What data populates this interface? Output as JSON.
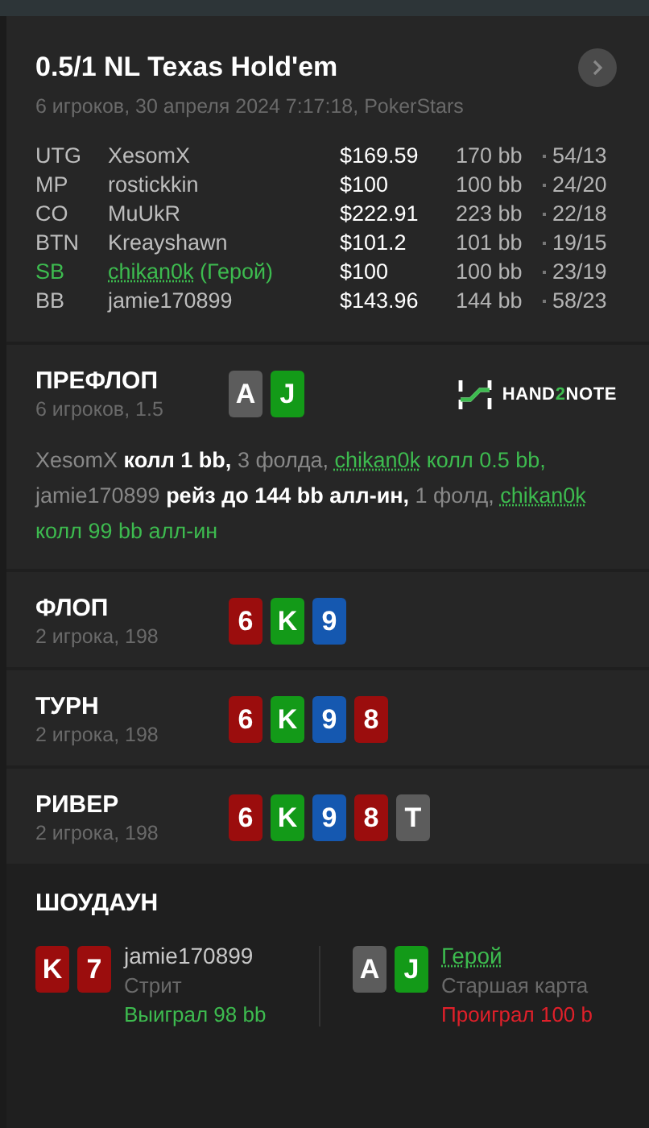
{
  "hand": {
    "title": "0.5/1 NL Texas Hold'em",
    "subtitle": "6 игроков, 30 апреля 2024 7:17:18, PokerStars"
  },
  "players": [
    {
      "position": "UTG",
      "name": "XesomX",
      "stack": "$169.59",
      "bb": "170 bb",
      "stats": "54/13",
      "hero": false
    },
    {
      "position": "MP",
      "name": "rostickkin",
      "stack": "$100",
      "bb": "100 bb",
      "stats": "24/20",
      "hero": false
    },
    {
      "position": "CO",
      "name": "MuUkR",
      "stack": "$222.91",
      "bb": "223 bb",
      "stats": "22/18",
      "hero": false
    },
    {
      "position": "BTN",
      "name": "Kreayshawn",
      "stack": "$101.2",
      "bb": "101 bb",
      "stats": "19/15",
      "hero": false
    },
    {
      "position": "SB",
      "name": "chikan0k",
      "hero_tag": "(Герой)",
      "stack": "$100",
      "bb": "100 bb",
      "stats": "23/19",
      "hero": true
    },
    {
      "position": "BB",
      "name": "jamie170899",
      "stack": "$143.96",
      "bb": "144 bb",
      "stats": "58/23",
      "hero": false
    }
  ],
  "logo": {
    "parts": [
      "HAND",
      "2",
      "NOTE"
    ]
  },
  "streets": [
    {
      "title": "ПРЕФЛОП",
      "info": "6 игроков, 1.5",
      "cards": [
        {
          "rank": "A",
          "color": "#5c5c5c"
        },
        {
          "rank": "J",
          "color": "#139a18"
        }
      ],
      "actions": [
        {
          "kind": "player",
          "text": "XesomX",
          "hero": false
        },
        {
          "kind": "action",
          "text": " колл 1 bb,",
          "hero": false
        },
        {
          "kind": "other",
          "text": " 3 фолда, ",
          "hero": false
        },
        {
          "kind": "player",
          "text": "chikan0k",
          "hero": true
        },
        {
          "kind": "action",
          "text": " колл 0.5 bb,",
          "hero": true
        },
        {
          "kind": "player",
          "text": " jamie170899",
          "hero": false
        },
        {
          "kind": "action",
          "text": " рейз до 144 bb алл-ин,",
          "hero": false
        },
        {
          "kind": "other",
          "text": " 1 фолд, ",
          "hero": false
        },
        {
          "kind": "player",
          "text": "chikan0k",
          "hero": true
        },
        {
          "kind": "action",
          "text": " колл 99 bb алл-ин",
          "hero": true
        }
      ]
    },
    {
      "title": "ФЛОП",
      "info": "2 игрока, 198",
      "cards": [
        {
          "rank": "6",
          "color": "#9b0d0d"
        },
        {
          "rank": "K",
          "color": "#139a18"
        },
        {
          "rank": "9",
          "color": "#1558b0"
        }
      ]
    },
    {
      "title": "ТУРН",
      "info": "2 игрока, 198",
      "cards": [
        {
          "rank": "6",
          "color": "#9b0d0d"
        },
        {
          "rank": "K",
          "color": "#139a18"
        },
        {
          "rank": "9",
          "color": "#1558b0"
        },
        {
          "rank": "8",
          "color": "#9b0d0d"
        }
      ]
    },
    {
      "title": "РИВЕР",
      "info": "2 игрока, 198",
      "cards": [
        {
          "rank": "6",
          "color": "#9b0d0d"
        },
        {
          "rank": "K",
          "color": "#139a18"
        },
        {
          "rank": "9",
          "color": "#1558b0"
        },
        {
          "rank": "8",
          "color": "#9b0d0d"
        },
        {
          "rank": "T",
          "color": "#5c5c5c"
        }
      ]
    }
  ],
  "showdown": {
    "title": "ШОУДАУН",
    "hands": [
      {
        "cards": [
          {
            "rank": "K",
            "color": "#9b0d0d"
          },
          {
            "rank": "7",
            "color": "#9b0d0d"
          }
        ],
        "name": "jamie170899",
        "hero": false,
        "combo": "Стрит",
        "result": "Выиграл 98 bb",
        "won": true
      },
      {
        "cards": [
          {
            "rank": "A",
            "color": "#5c5c5c"
          },
          {
            "rank": "J",
            "color": "#139a18"
          }
        ],
        "name": "Герой",
        "hero": true,
        "combo": "Старшая карта",
        "result": "Проиграл 100 b",
        "won": false
      }
    ]
  }
}
